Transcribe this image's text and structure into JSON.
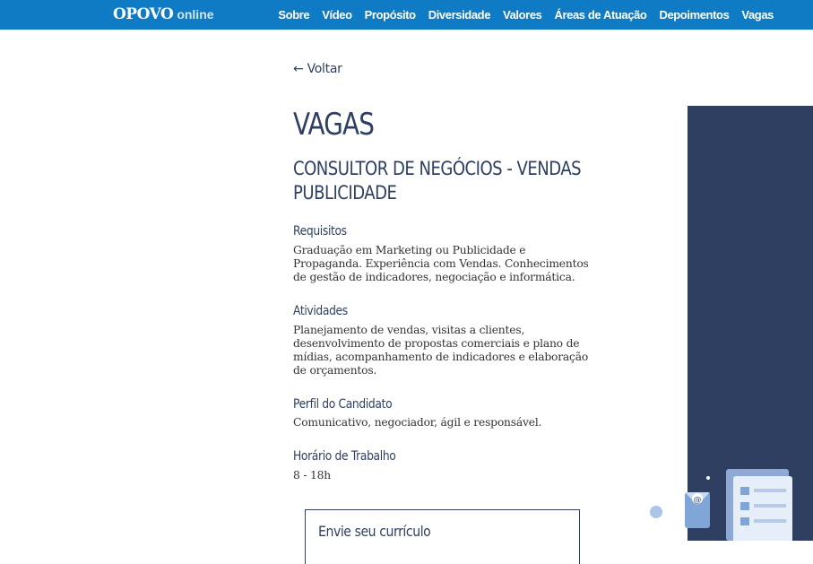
{
  "header": {
    "logo_main": "OPOVO",
    "logo_sub": "online",
    "nav": [
      "Sobre",
      "Vídeo",
      "Propósito",
      "Diversidade",
      "Valores",
      "Áreas de Atuação",
      "Depoimentos",
      "Vagas"
    ]
  },
  "back_link": "← Voltar",
  "page_title": "VAGAS",
  "job_title": "CONSULTOR DE NEGÓCIOS - VENDAS PUBLICIDADE",
  "sections": [
    {
      "label": "Requisitos",
      "text": "Graduação em Marketing ou Publicidade e Propaganda. Experiência com Vendas. Conhecimentos de gestão de indicadores, negociação e informática."
    },
    {
      "label": "Atividades",
      "text": "Planejamento de vendas, visitas a clientes, desenvolvimento de propostas comerciais e plano de mídias, acompanhamento de indicadores e elaboração de orçamentos."
    },
    {
      "label": "Perfil do Candidato",
      "text": "Comunicativo, negociador, ágil e responsável."
    },
    {
      "label": "Horário de Trabalho",
      "text": "8 - 18h"
    }
  ],
  "cv_box_title": "Envie seu currículo",
  "colors": {
    "header_bg": "#0e7bc4",
    "accent_navy": "#2e3f62"
  }
}
